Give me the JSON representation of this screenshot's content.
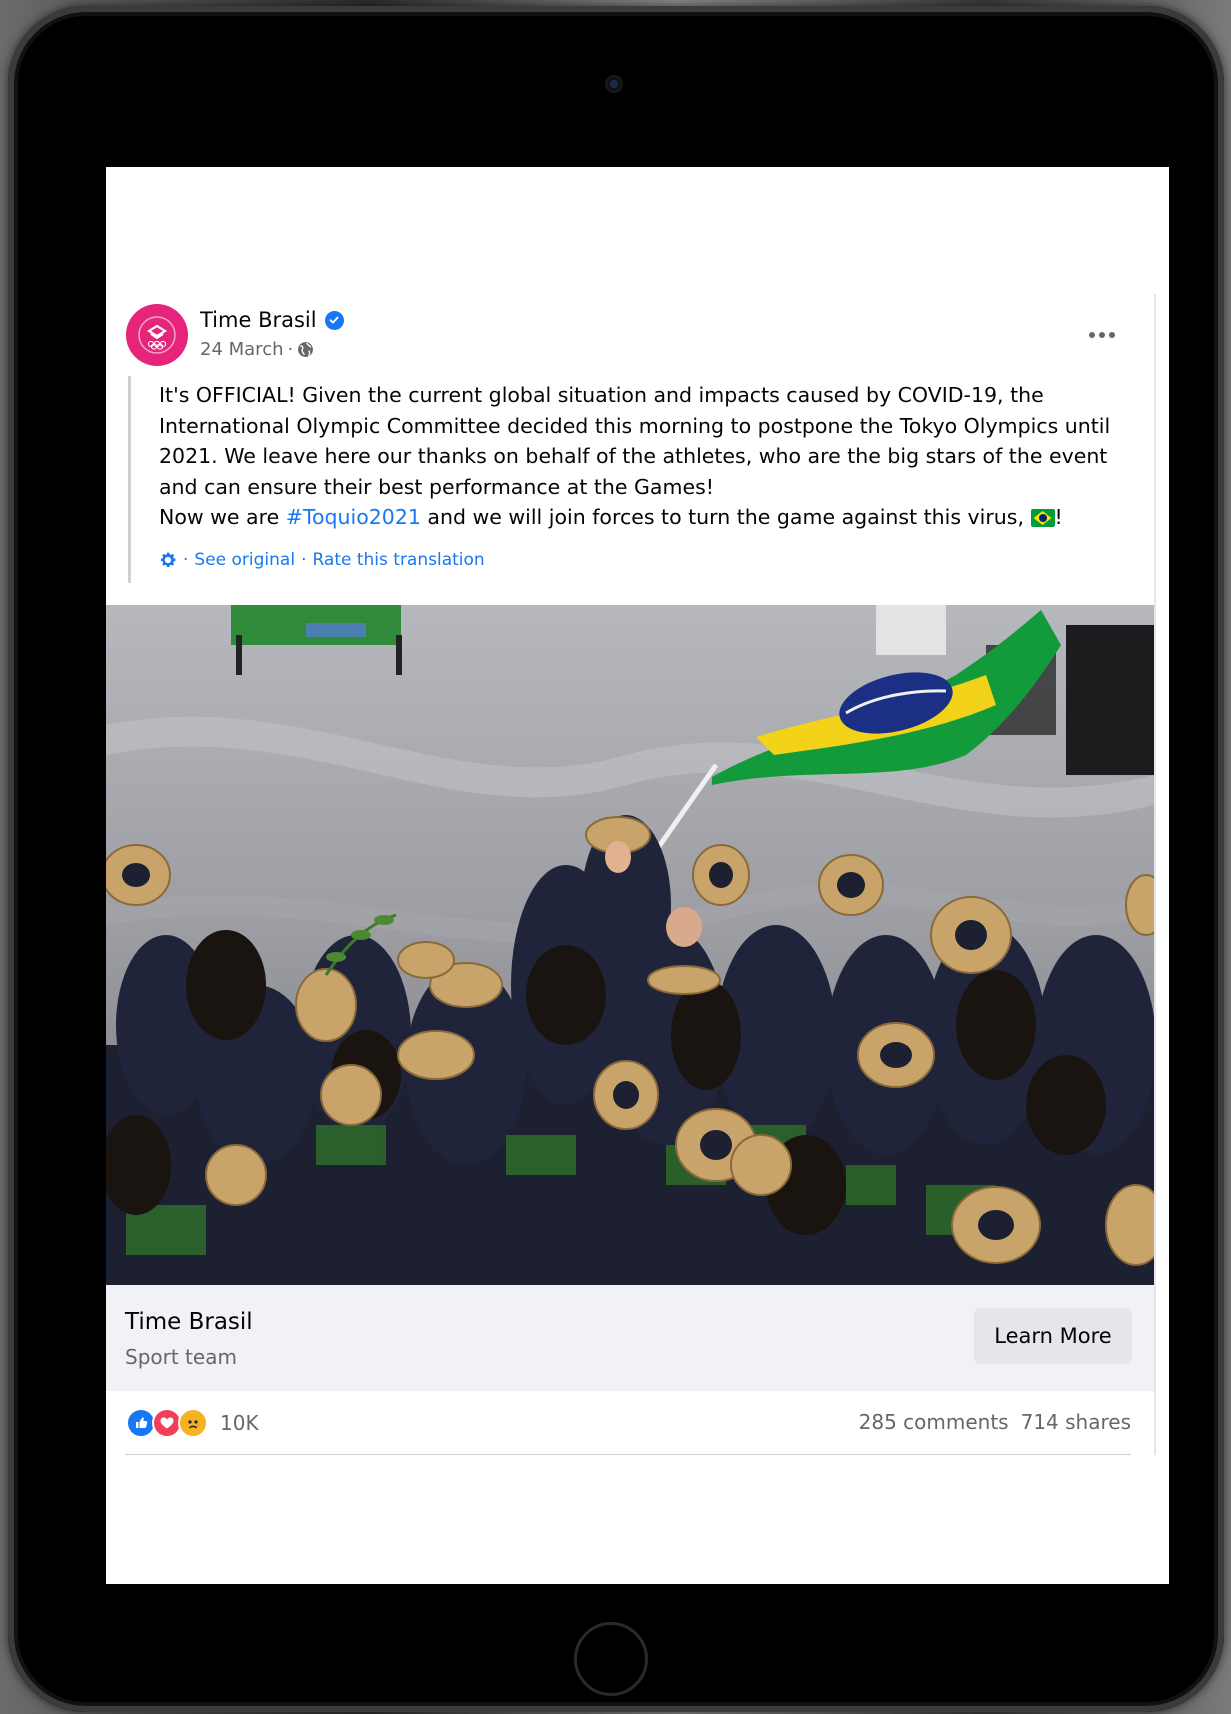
{
  "post": {
    "page_name": "Time Brasil",
    "date": "24 March",
    "date_separator": "·",
    "avatar_icon": "olympic-team-logo-icon",
    "text_lines": [
      "It's OFFICIAL! Given the current global situation and impacts caused by COVID-19, the",
      "International Olympic Committee decided this morning to postpone the Tokyo Olympics until",
      "2021. We leave here our thanks on behalf of the athletes, who are the big stars of the event",
      "and can ensure their best performance at the Games!"
    ],
    "last_line_prefix": "Now we are ",
    "hashtag": "#Toquio2021",
    "last_line_suffix": " and we will join forces to turn the game against this virus,",
    "last_line_end": "!",
    "translation": {
      "sep1": "·",
      "see_original": "See original",
      "sep2": "·",
      "rate": "Rate this translation"
    }
  },
  "link_footer": {
    "title": "Time Brasil",
    "subtitle": "Sport team",
    "cta": "Learn More"
  },
  "stats": {
    "reaction_count": "10K",
    "comments": "285 comments",
    "shares": "714 shares"
  },
  "colors": {
    "accent": "#1877f2",
    "avatar": "#e6247a",
    "brazil_green": "#009b3a",
    "brazil_yellow": "#fedf00",
    "brazil_blue": "#002776"
  }
}
